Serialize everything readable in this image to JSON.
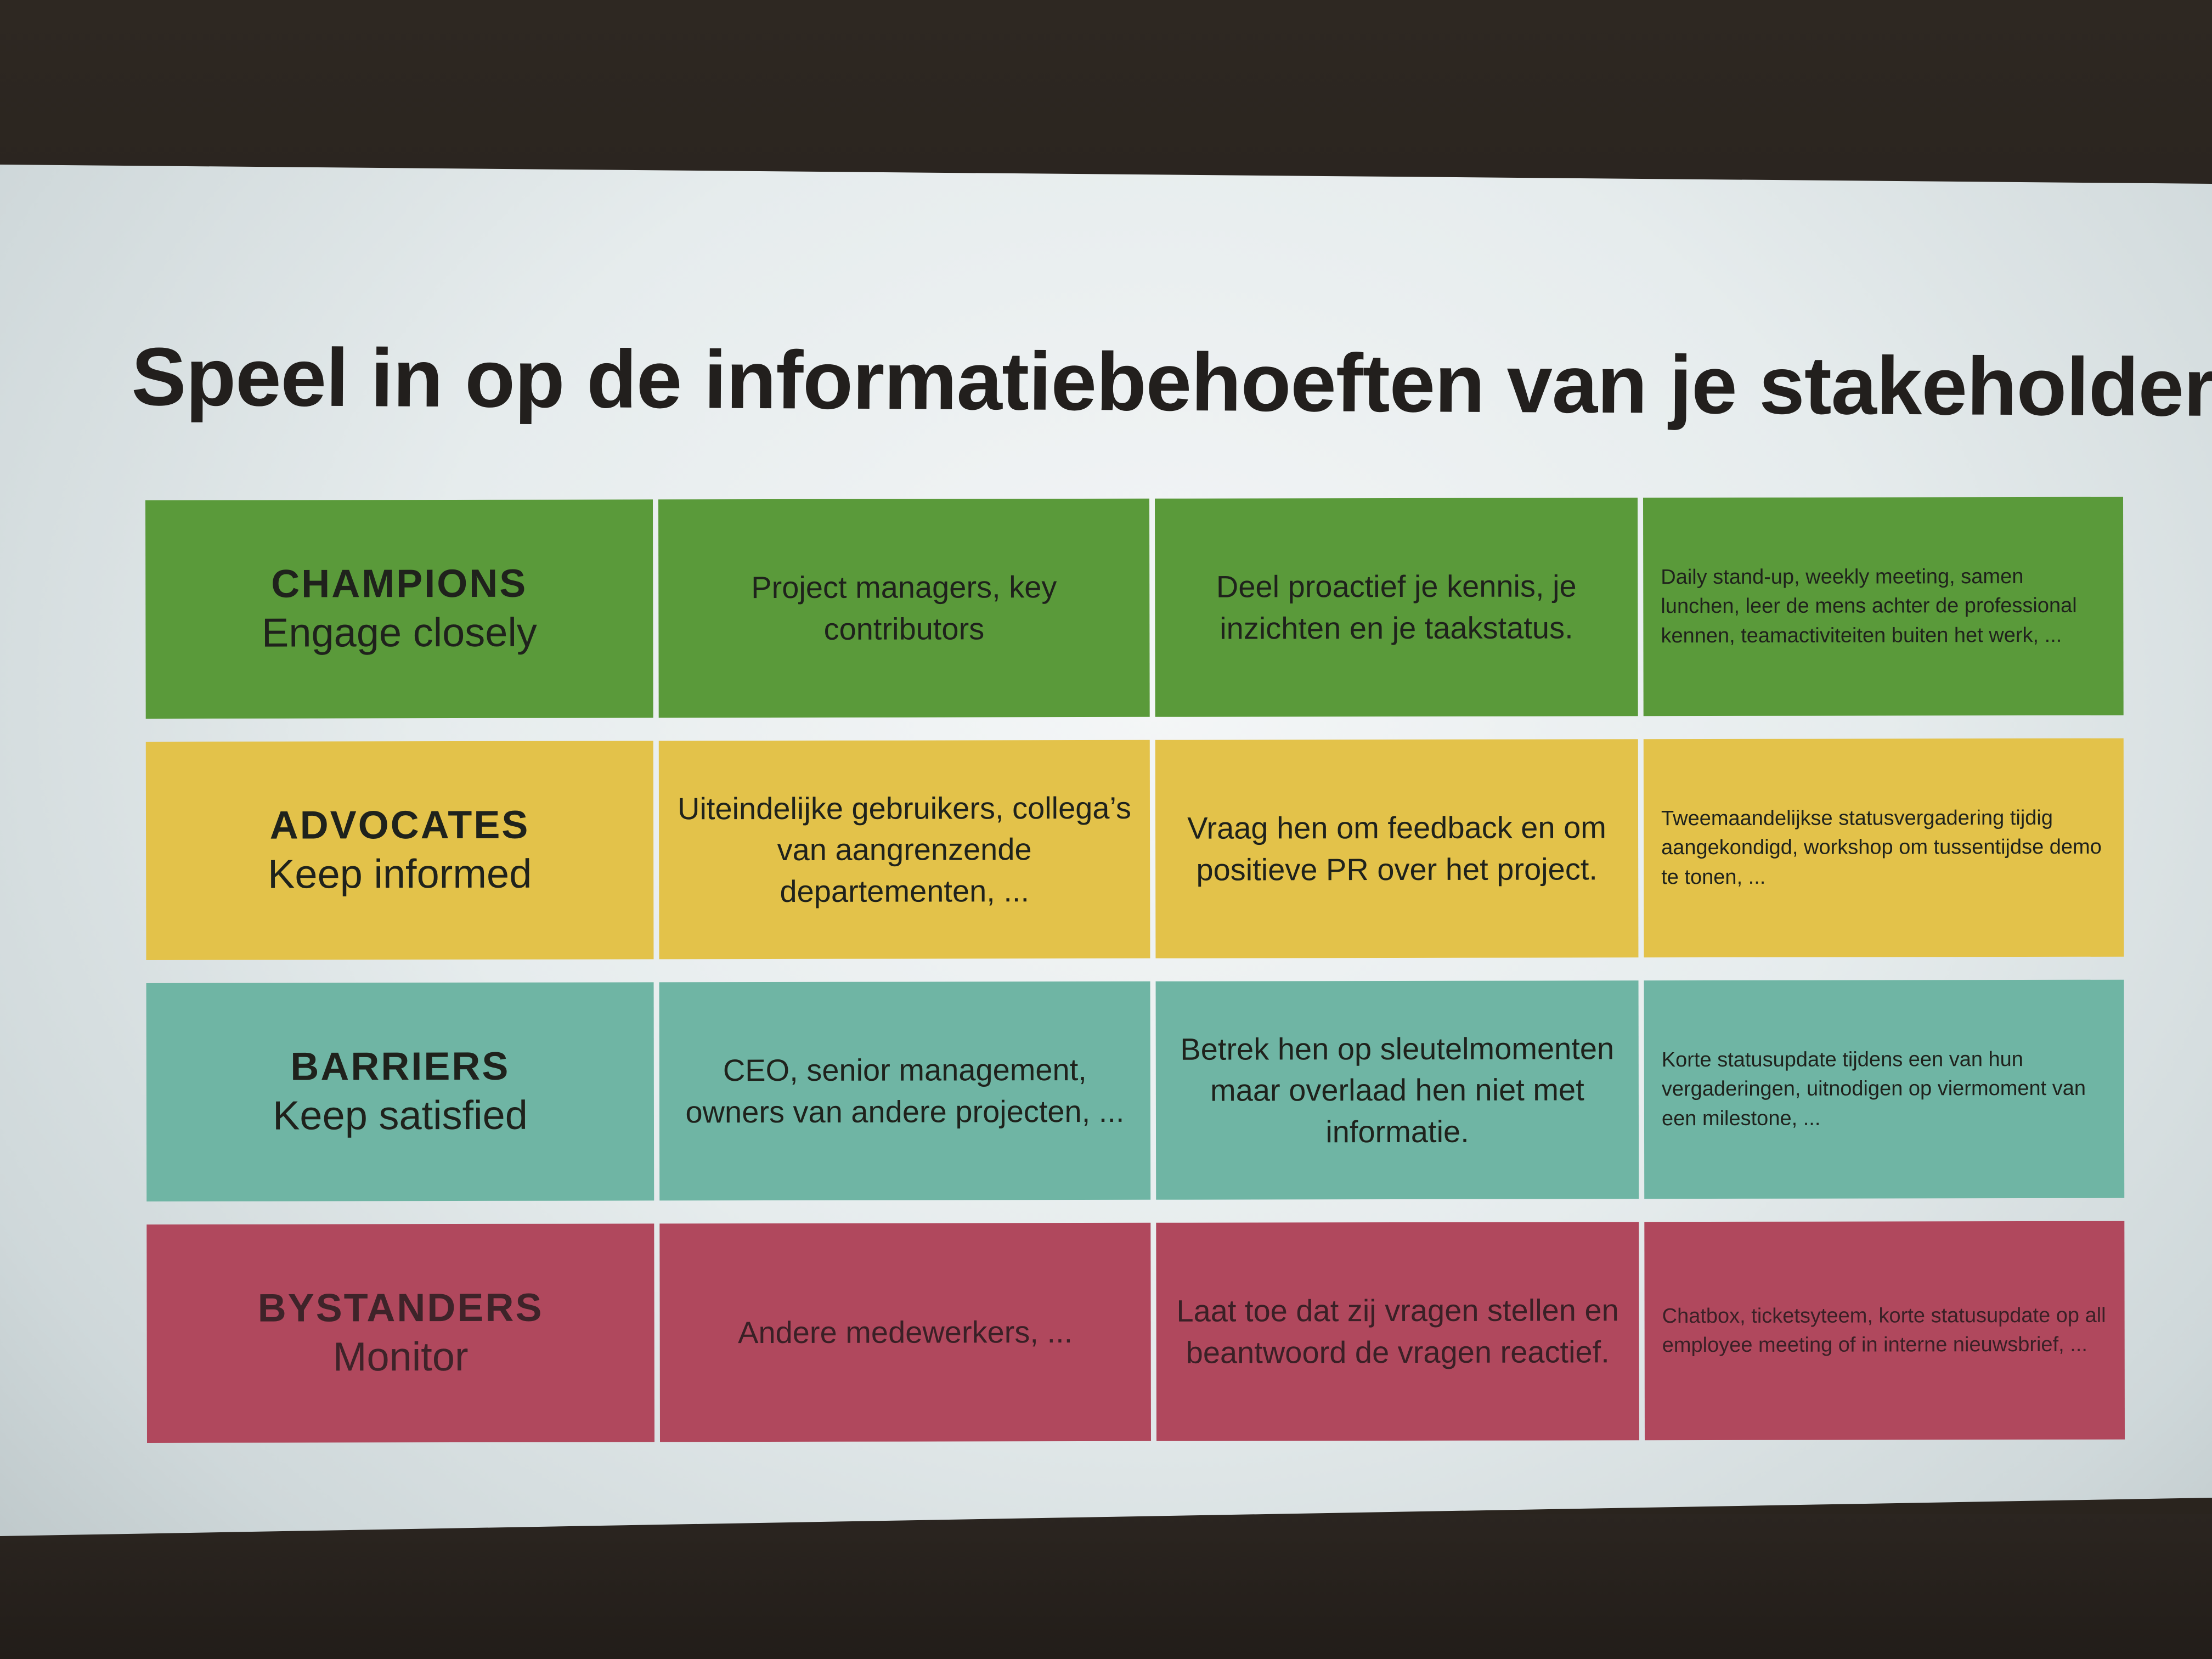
{
  "slide": {
    "title": "Speel in op de informatiebehoeften van je stakeholders",
    "rows": [
      {
        "category": "CHAMPIONS",
        "action": "Engage closely",
        "who": "Project managers, key contributors",
        "approach": "Deel proactief je kennis, je inzichten en je taakstatus.",
        "examples": "Daily stand-up, weekly meeting, samen lunchen, leer de mens achter de professional kennen, teamactiviteiten buiten het werk, ...",
        "color": "#5a9a3a"
      },
      {
        "category": "ADVOCATES",
        "action": "Keep informed",
        "who": "Uiteindelijke gebruikers, collega’s van aangrenzende departementen, ...",
        "approach": "Vraag hen om feedback en om positieve PR over het project.",
        "examples": "Tweemaandelijkse statusvergadering tijdig aangekondigd, workshop om tussentijdse demo te tonen, ...",
        "color": "#e3c24a"
      },
      {
        "category": "BARRIERS",
        "action": "Keep satisfied",
        "who": "CEO, senior management, owners van andere projecten, ...",
        "approach": "Betrek hen op sleutelmomenten maar overlaad hen niet met informatie.",
        "examples": "Korte statusupdate tijdens een van hun vergaderingen, uitnodigen op viermoment van een milestone, ...",
        "color": "#6fb5a4"
      },
      {
        "category": "BYSTANDERS",
        "action": "Monitor",
        "who": "Andere medewerkers, ...",
        "approach": "Laat toe dat zij vragen stellen en beantwoord de vragen reactief.",
        "examples": "Chatbox, ticketsyteem, korte statusupdate op all employee meeting of in interne nieuwsbrief, ...",
        "color": "#b0485d"
      }
    ]
  }
}
